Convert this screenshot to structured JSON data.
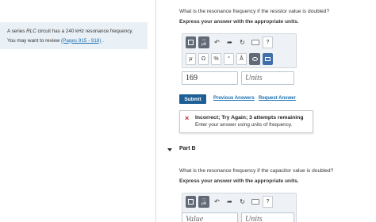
{
  "left_panel": {
    "intro_prefix": "A series ",
    "intro_em": "RLC",
    "intro_suffix": " circuit has a 240 kHz resonance frequency.",
    "review_prefix": "You may want to review ",
    "review_link": "(Pages 915 - 918)",
    "review_suffix": " ."
  },
  "part_a": {
    "question": "What is the resonance frequency if the resistor value is doubled?",
    "instruction": "Express your answer with the appropriate units.",
    "toolbar": {
      "row1": [
        "templates-icon",
        "symbols-icon",
        "undo-icon",
        "redo-icon",
        "reset-icon",
        "keyboard-icon",
        "help-icon"
      ],
      "row2_labels": [
        "μ",
        "Ω",
        "%",
        "°",
        "Å"
      ],
      "help_label": "?",
      "symbols_label": "μA"
    },
    "value": "169",
    "units_placeholder": "Units",
    "submit_label": "Submit",
    "previous_answers_label": "Previous Answers",
    "request_answer_label": "Request Answer",
    "feedback": {
      "icon": "×",
      "title": "Incorrect; Try Again; 3 attempts remaining",
      "message": "Enter your answer using units of frequency."
    }
  },
  "part_b": {
    "label": "Part B",
    "question": "What is the resonance frequency if the capacitor value is doubled?",
    "instruction": "Express your answer with the appropriate units.",
    "value_placeholder": "Value",
    "units_placeholder": "Units",
    "help_label": "?",
    "symbols_label": "μA"
  },
  "colors": {
    "accent": "#1d5f94",
    "link": "#1a6fb2",
    "error": "#c62828",
    "panel_bg": "#eaf1f6"
  }
}
